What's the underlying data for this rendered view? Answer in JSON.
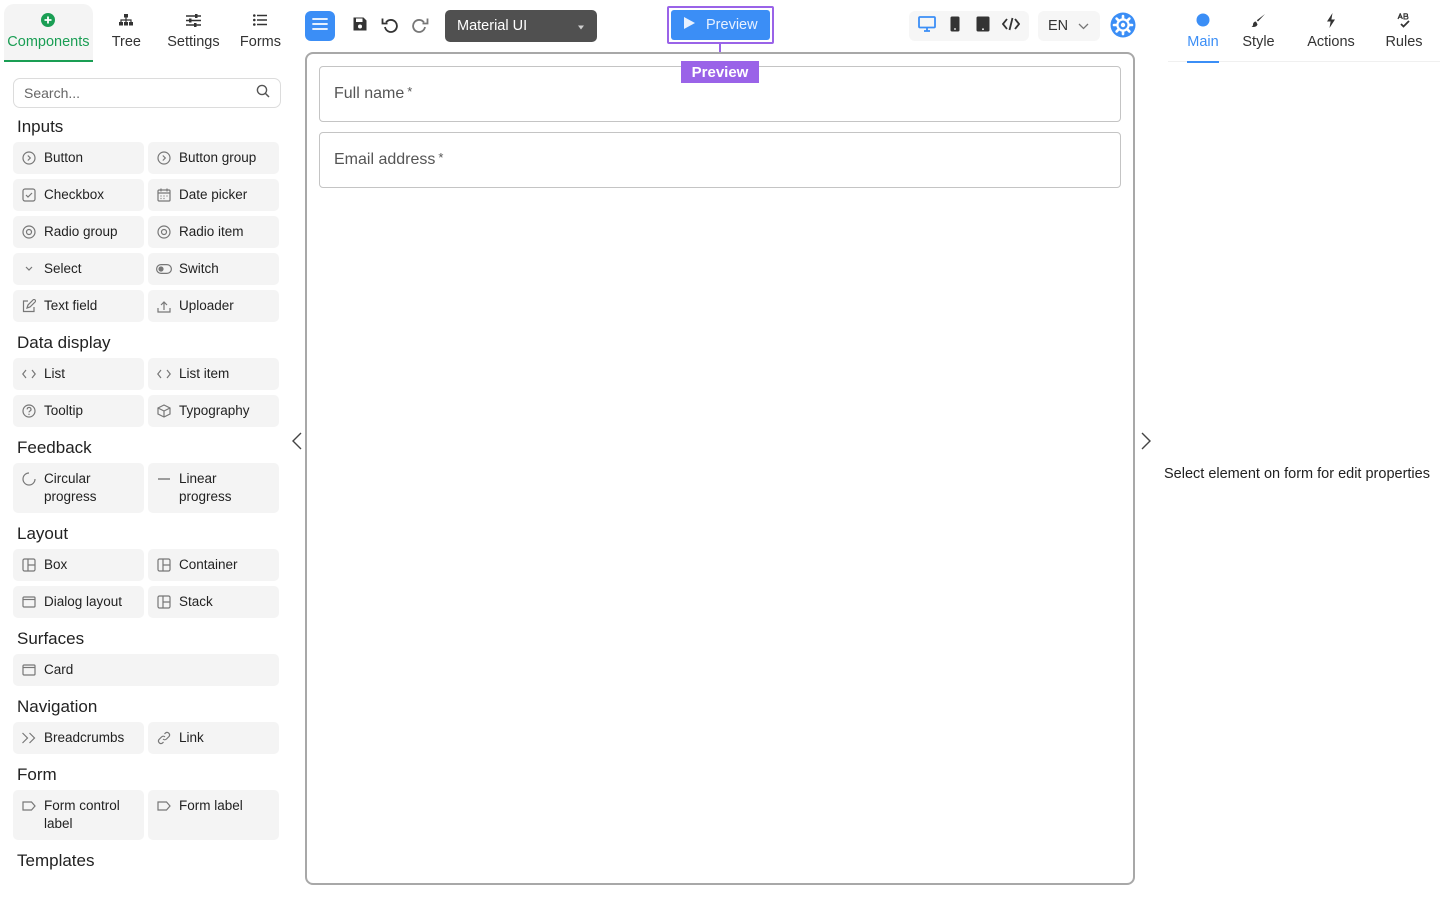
{
  "left_tabs": [
    {
      "label": "Components",
      "icon": "plus-circle-icon",
      "active": true
    },
    {
      "label": "Tree",
      "icon": "sitemap-icon"
    },
    {
      "label": "Settings",
      "icon": "sliders-icon"
    },
    {
      "label": "Forms",
      "icon": "list-icon"
    }
  ],
  "search": {
    "placeholder": "Search..."
  },
  "palette": {
    "inputs": {
      "title": "Inputs",
      "items": [
        "Button",
        "Button group",
        "Checkbox",
        "Date picker",
        "Radio group",
        "Radio item",
        "Select",
        "Switch",
        "Text field",
        "Uploader"
      ]
    },
    "data_display": {
      "title": "Data display",
      "items": [
        "List",
        "List item",
        "Tooltip",
        "Typography"
      ]
    },
    "feedback": {
      "title": "Feedback",
      "items": [
        "Circular progress",
        "Linear progress"
      ]
    },
    "layout": {
      "title": "Layout",
      "items": [
        "Box",
        "Container",
        "Dialog layout",
        "Stack"
      ]
    },
    "surfaces": {
      "title": "Surfaces",
      "items": [
        "Card"
      ]
    },
    "navigation": {
      "title": "Navigation",
      "items": [
        "Breadcrumbs",
        "Link"
      ]
    },
    "form": {
      "title": "Form",
      "items": [
        "Form control label",
        "Form label"
      ]
    },
    "templates": {
      "title": "Templates"
    }
  },
  "toolbar": {
    "theme_value": "Material UI",
    "preview_label": "Preview",
    "preview_tag": "Preview",
    "language": "EN",
    "accent": "#3b8ef6",
    "highlight": "#9a63e8"
  },
  "canvas": {
    "fields": [
      {
        "label": "Full name",
        "required_mark": "*"
      },
      {
        "label": "Email address",
        "required_mark": "*"
      }
    ]
  },
  "right_tabs": [
    {
      "label": "Main",
      "icon": "circle-icon",
      "active": true
    },
    {
      "label": "Style",
      "icon": "brush-icon"
    },
    {
      "label": "Actions",
      "icon": "lightning-icon"
    },
    {
      "label": "Rules",
      "icon": "rules-icon"
    }
  ],
  "right_panel": {
    "message": "Select element on form for edit properties"
  }
}
